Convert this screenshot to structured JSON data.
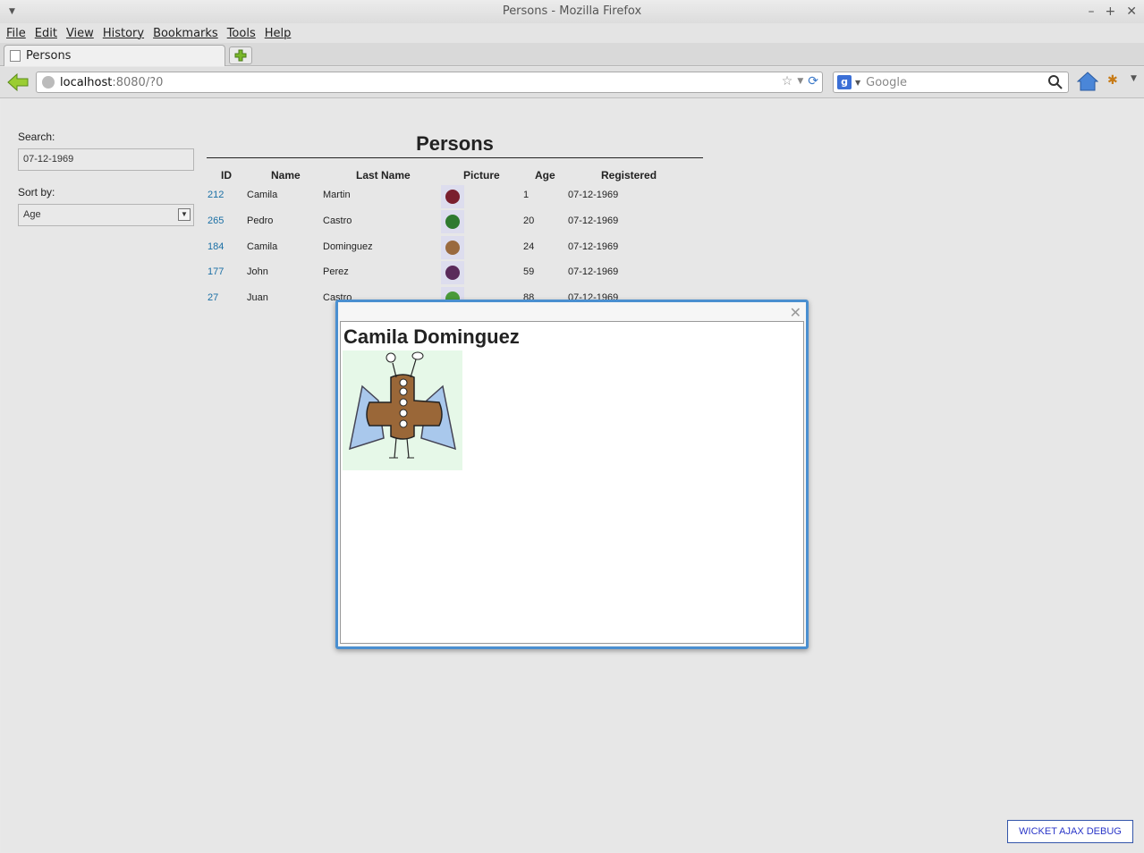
{
  "window": {
    "title": "Persons - Mozilla Firefox"
  },
  "menu": [
    "File",
    "Edit",
    "View",
    "History",
    "Bookmarks",
    "Tools",
    "Help"
  ],
  "tab": {
    "label": "Persons"
  },
  "url": {
    "host": "localhost",
    "rest": ":8080/?0"
  },
  "search_engine": {
    "placeholder": "Google"
  },
  "sidebar": {
    "search_label": "Search:",
    "search_value": "07-12-1969",
    "sort_label": "Sort by:",
    "sort_value": "Age"
  },
  "table": {
    "title": "Persons",
    "headers": [
      "ID",
      "Name",
      "Last Name",
      "Picture",
      "Age",
      "Registered"
    ],
    "rows": [
      {
        "id": "212",
        "name": "Camila",
        "last": "Martin",
        "age": "1",
        "registered": "07-12-1969",
        "thumb_color": "#7a1f2e"
      },
      {
        "id": "265",
        "name": "Pedro",
        "last": "Castro",
        "age": "20",
        "registered": "07-12-1969",
        "thumb_color": "#2f7a2f"
      },
      {
        "id": "184",
        "name": "Camila",
        "last": "Dominguez",
        "age": "24",
        "registered": "07-12-1969",
        "thumb_color": "#9a6a3f"
      },
      {
        "id": "177",
        "name": "John",
        "last": "Perez",
        "age": "59",
        "registered": "07-12-1969",
        "thumb_color": "#5a2a5a"
      },
      {
        "id": "27",
        "name": "Juan",
        "last": "Castro",
        "age": "88",
        "registered": "07-12-1969",
        "thumb_color": "#4a9a3a"
      }
    ]
  },
  "modal": {
    "title": "Camila Dominguez",
    "close_icon": "close-icon"
  },
  "debug": {
    "label": "WICKET AJAX DEBUG"
  }
}
